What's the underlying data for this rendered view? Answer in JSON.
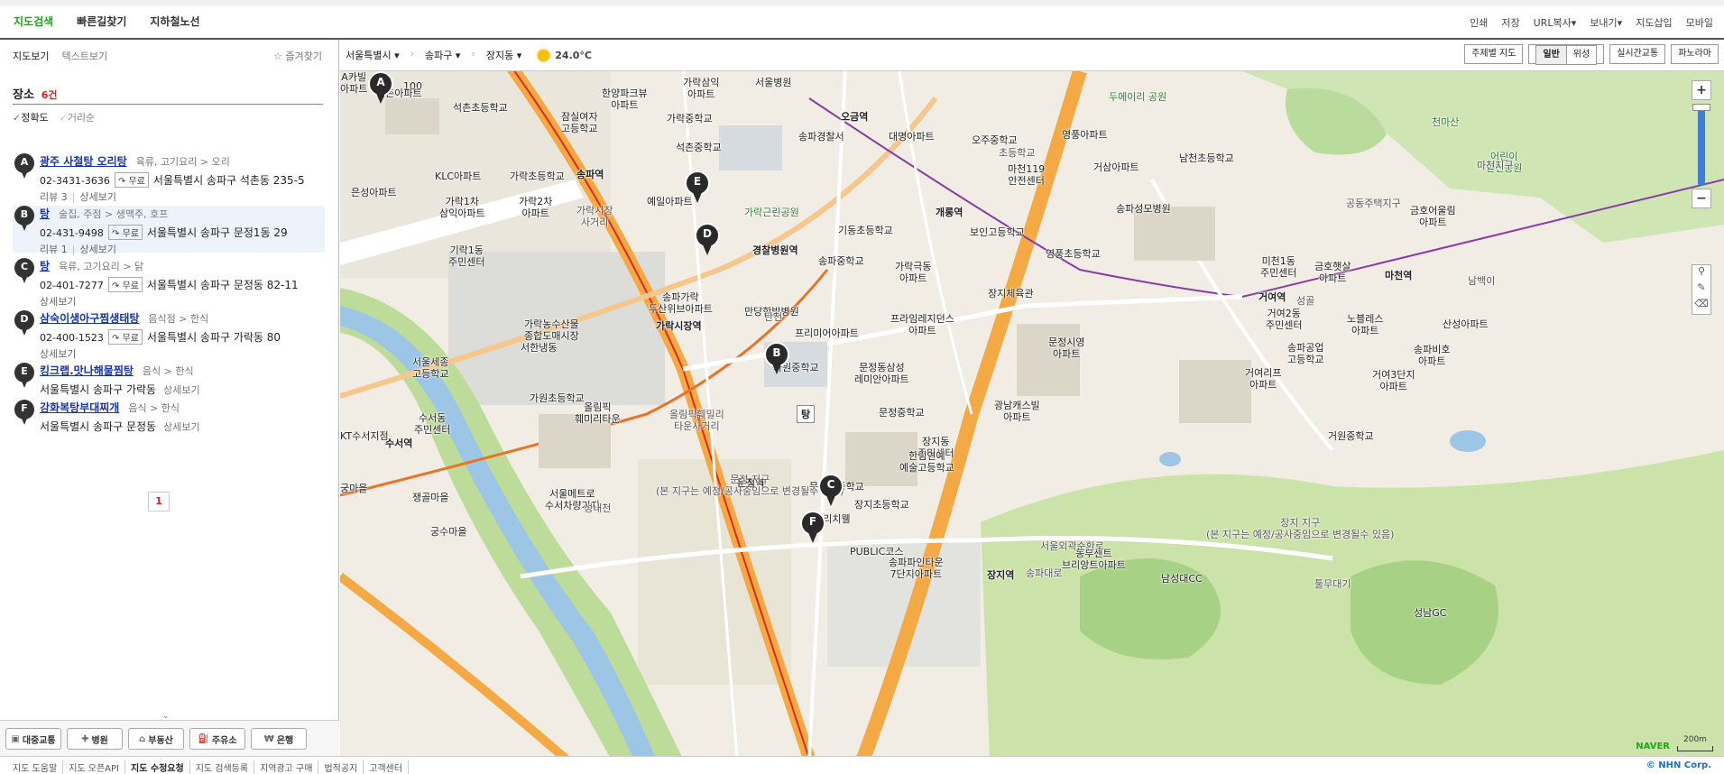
{
  "topnav": {
    "items": [
      "지도검색",
      "빠른길찾기",
      "지하철노선"
    ]
  },
  "utilnav": {
    "items": [
      "인쇄",
      "저장",
      "URL복사",
      "보내기",
      "지도삽입",
      "모바일"
    ]
  },
  "left": {
    "view_tabs": [
      "지도보기",
      "텍스트보기"
    ],
    "favorites": "즐겨찾기",
    "result_title": "장소",
    "result_count": "6건",
    "sort": {
      "accuracy": "정확도",
      "distance": "거리순"
    },
    "results": [
      {
        "marker": "A",
        "name": "광주 사철탕 오리탕",
        "category": "육류, 고기요리 > 오리",
        "phone": "02-3431-3636",
        "free": "무료",
        "address": "서울특별시 송파구 석촌동 235-5",
        "review": "리뷰 3",
        "detail": "상세보기"
      },
      {
        "marker": "B",
        "name": "탕",
        "category": "술집, 주점 > 생맥주, 호프",
        "phone": "02-431-9498",
        "free": "무료",
        "address": "서울특별시 송파구 문정1동 29",
        "review": "리뷰 1",
        "detail": "상세보기"
      },
      {
        "marker": "C",
        "name": "탕",
        "category": "육류, 고기요리 > 닭",
        "phone": "02-401-7277",
        "free": "무료",
        "address": "서울특별시 송파구 문정동 82-11",
        "review": "",
        "detail": "상세보기"
      },
      {
        "marker": "D",
        "name": "삼숙이생아구찜생태탕",
        "category": "음식점 > 한식",
        "phone": "02-400-1523",
        "free": "무료",
        "address": "서울특별시 송파구 가락동 80",
        "review": "",
        "detail": "상세보기"
      },
      {
        "marker": "E",
        "name": "킹크랩.맛나해물찜탕",
        "category": "음식 > 한식",
        "phone": "",
        "free": "",
        "address": "서울특별시 송파구 가락동",
        "review": "",
        "detail": "상세보기"
      },
      {
        "marker": "F",
        "name": "강화복탕부대찌개",
        "category": "음식 > 한식",
        "phone": "",
        "free": "",
        "address": "서울특별시 송파구 문정동",
        "review": "",
        "detail": "상세보기"
      }
    ],
    "page": "1",
    "categories": [
      "대중교통",
      "병원",
      "부동산",
      "주유소",
      "은행"
    ]
  },
  "mapbar": {
    "crumbs": [
      "서울특별시",
      "송파구",
      "장지동"
    ],
    "temperature": "24.0°C",
    "types": [
      "주제별 지도",
      "일반",
      "위성",
      "실시간교통",
      "파노라마"
    ],
    "selected_type": "일반"
  },
  "map": {
    "labels": [
      {
        "t": "석촌초등학교",
        "k": ""
      },
      {
        "t": "한양파크뷰\n아파트",
        "k": ""
      },
      {
        "t": "가락삼익\n아파트",
        "k": ""
      },
      {
        "t": "서울병원",
        "k": ""
      },
      {
        "t": "잠실여자\n고등학교",
        "k": ""
      },
      {
        "t": "가락중학교",
        "k": ""
      },
      {
        "t": "석촌중학교",
        "k": ""
      },
      {
        "t": "송파역",
        "k": "st"
      },
      {
        "t": "오금역",
        "k": "st"
      },
      {
        "t": "송파경찰서",
        "k": ""
      },
      {
        "t": "대명아파트",
        "k": ""
      },
      {
        "t": "오주중학교",
        "k": ""
      },
      {
        "t": "영풍아파트",
        "k": ""
      },
      {
        "t": "두에이리 공원",
        "k": "pk"
      },
      {
        "t": "KLC아파트",
        "k": ""
      },
      {
        "t": "가락초등학교",
        "k": ""
      },
      {
        "t": "은성아파트",
        "k": ""
      },
      {
        "t": "가락1차\n삼익아파트",
        "k": ""
      },
      {
        "t": "가락2차\n아파트",
        "k": ""
      },
      {
        "t": "가락시장\n사거리",
        "k": "ac"
      },
      {
        "t": "예일아파트",
        "k": ""
      },
      {
        "t": "가락근린공원",
        "k": "pk"
      },
      {
        "t": "마천119\n안전센터",
        "k": ""
      },
      {
        "t": "거삼아파트",
        "k": ""
      },
      {
        "t": "남천초등학교",
        "k": ""
      },
      {
        "t": "천마산",
        "k": "pk"
      },
      {
        "t": "어린이\n안전공원",
        "k": "pk"
      },
      {
        "t": "개롱역",
        "k": "st"
      },
      {
        "t": "송파성모병원",
        "k": ""
      },
      {
        "t": "기동초등학교",
        "k": ""
      },
      {
        "t": "보인고등학교",
        "k": ""
      },
      {
        "t": "금호어울림\n아파트",
        "k": ""
      },
      {
        "t": "기락1동\n주민센터",
        "k": ""
      },
      {
        "t": "경찰병원역",
        "k": "st"
      },
      {
        "t": "송파중학교",
        "k": ""
      },
      {
        "t": "가락극동\n아파트",
        "k": ""
      },
      {
        "t": "영풍초등학교",
        "k": ""
      },
      {
        "t": "미천1동\n주민센터",
        "k": ""
      },
      {
        "t": "금호햇살\n아파트",
        "k": ""
      },
      {
        "t": "마천역",
        "k": "st"
      },
      {
        "t": "가락농수산물\n종합도매시장",
        "k": ""
      },
      {
        "t": "송파가락\n두산위브아파트",
        "k": ""
      },
      {
        "t": "만당한방병원",
        "k": ""
      },
      {
        "t": "장지체육관",
        "k": ""
      },
      {
        "t": "거여역",
        "k": "st"
      },
      {
        "t": "가락시장역",
        "k": "st"
      },
      {
        "t": "프리미어아파트",
        "k": ""
      },
      {
        "t": "프라임레지던스\n아파트",
        "k": ""
      },
      {
        "t": "거여2동\n주민센터",
        "k": ""
      },
      {
        "t": "노블레스\n아파트",
        "k": ""
      },
      {
        "t": "산성아파트",
        "k": ""
      },
      {
        "t": "서한냉동",
        "k": ""
      },
      {
        "t": "송파공업\n고등학교",
        "k": ""
      },
      {
        "t": "송파비호\n아파트",
        "k": ""
      },
      {
        "t": "서울세종\n고등학교",
        "k": ""
      },
      {
        "t": "가원중학교",
        "k": ""
      },
      {
        "t": "문정시영\n아파트",
        "k": ""
      },
      {
        "t": "거여리프\n아파트",
        "k": ""
      },
      {
        "t": "거여3단지\n아파트",
        "k": ""
      },
      {
        "t": "가원초등학교",
        "k": ""
      },
      {
        "t": "문정동삼성\n레미안아파트",
        "k": ""
      },
      {
        "t": "수서동\n주민센터",
        "k": ""
      },
      {
        "t": "올림픽\n훼미리타운",
        "k": ""
      },
      {
        "t": "올림픽훼밀리\n타운사거리",
        "k": "ac"
      },
      {
        "t": "광남캐스빌\n아파트",
        "k": ""
      },
      {
        "t": "KT수서지점",
        "k": ""
      },
      {
        "t": "수서역",
        "k": "st"
      },
      {
        "t": "문정중학교",
        "k": ""
      },
      {
        "t": "거원중학교",
        "k": ""
      },
      {
        "t": "장지동\n주민센터",
        "k": ""
      },
      {
        "t": "문정역",
        "k": "st"
      },
      {
        "t": "한림연예\n예술고등학교",
        "k": ""
      },
      {
        "t": "문정고등학교",
        "k": ""
      },
      {
        "t": "문정 지구\n(본 지구는 예정/공사중임으로 변경될수 있음)",
        "k": "ac"
      },
      {
        "t": "궁마을",
        "k": ""
      },
      {
        "t": "쟁골마을",
        "k": ""
      },
      {
        "t": "서울메트로\n수서차량기지",
        "k": ""
      },
      {
        "t": "동궁리치웰",
        "k": ""
      },
      {
        "t": "장지초등학교",
        "k": ""
      },
      {
        "t": "궁수마을",
        "k": ""
      },
      {
        "t": "장지 지구\n(본 지구는 예정/공사중임으로 변경될수 있음)",
        "k": "ac"
      },
      {
        "t": "동부센트\n브리앙트아파트",
        "k": ""
      },
      {
        "t": "PUBLIC코스",
        "k": ""
      },
      {
        "t": "장지역",
        "k": "st"
      },
      {
        "t": "송파파인타운\n7단지아파트",
        "k": ""
      },
      {
        "t": "남성대CC",
        "k": ""
      },
      {
        "t": "성남GC",
        "k": ""
      },
      {
        "t": "툴무대기",
        "k": "ac"
      },
      {
        "t": "성골",
        "k": "ac"
      },
      {
        "t": "마천지구",
        "k": "ac"
      },
      {
        "t": "공동주택지구",
        "k": "ac"
      },
      {
        "t": "남백이",
        "k": "ac"
      },
      {
        "t": "초등학교",
        "k": "ac"
      },
      {
        "t": "성내천",
        "k": "ac"
      },
      {
        "t": "탄천",
        "k": "ac"
      },
      {
        "t": "송파대로",
        "k": "ac"
      },
      {
        "t": "서울외곽순환로",
        "k": "ac"
      },
      {
        "t": "100",
        "k": ""
      },
      {
        "t": "석촌아파트",
        "k": ""
      },
      {
        "t": "A카빌\n아파트",
        "k": ""
      }
    ],
    "pins": [
      "A",
      "B",
      "C",
      "D",
      "E",
      "F"
    ],
    "selected_tag": "탕",
    "scale": "200m",
    "brand": "NAVER"
  },
  "footer": {
    "links": [
      "지도 도움말",
      "지도 오픈API",
      "지도 수정요청",
      "지도 검색등록",
      "지역광고 구매",
      "법적공지",
      "고객센터"
    ],
    "copyright": "© NHN Corp."
  }
}
